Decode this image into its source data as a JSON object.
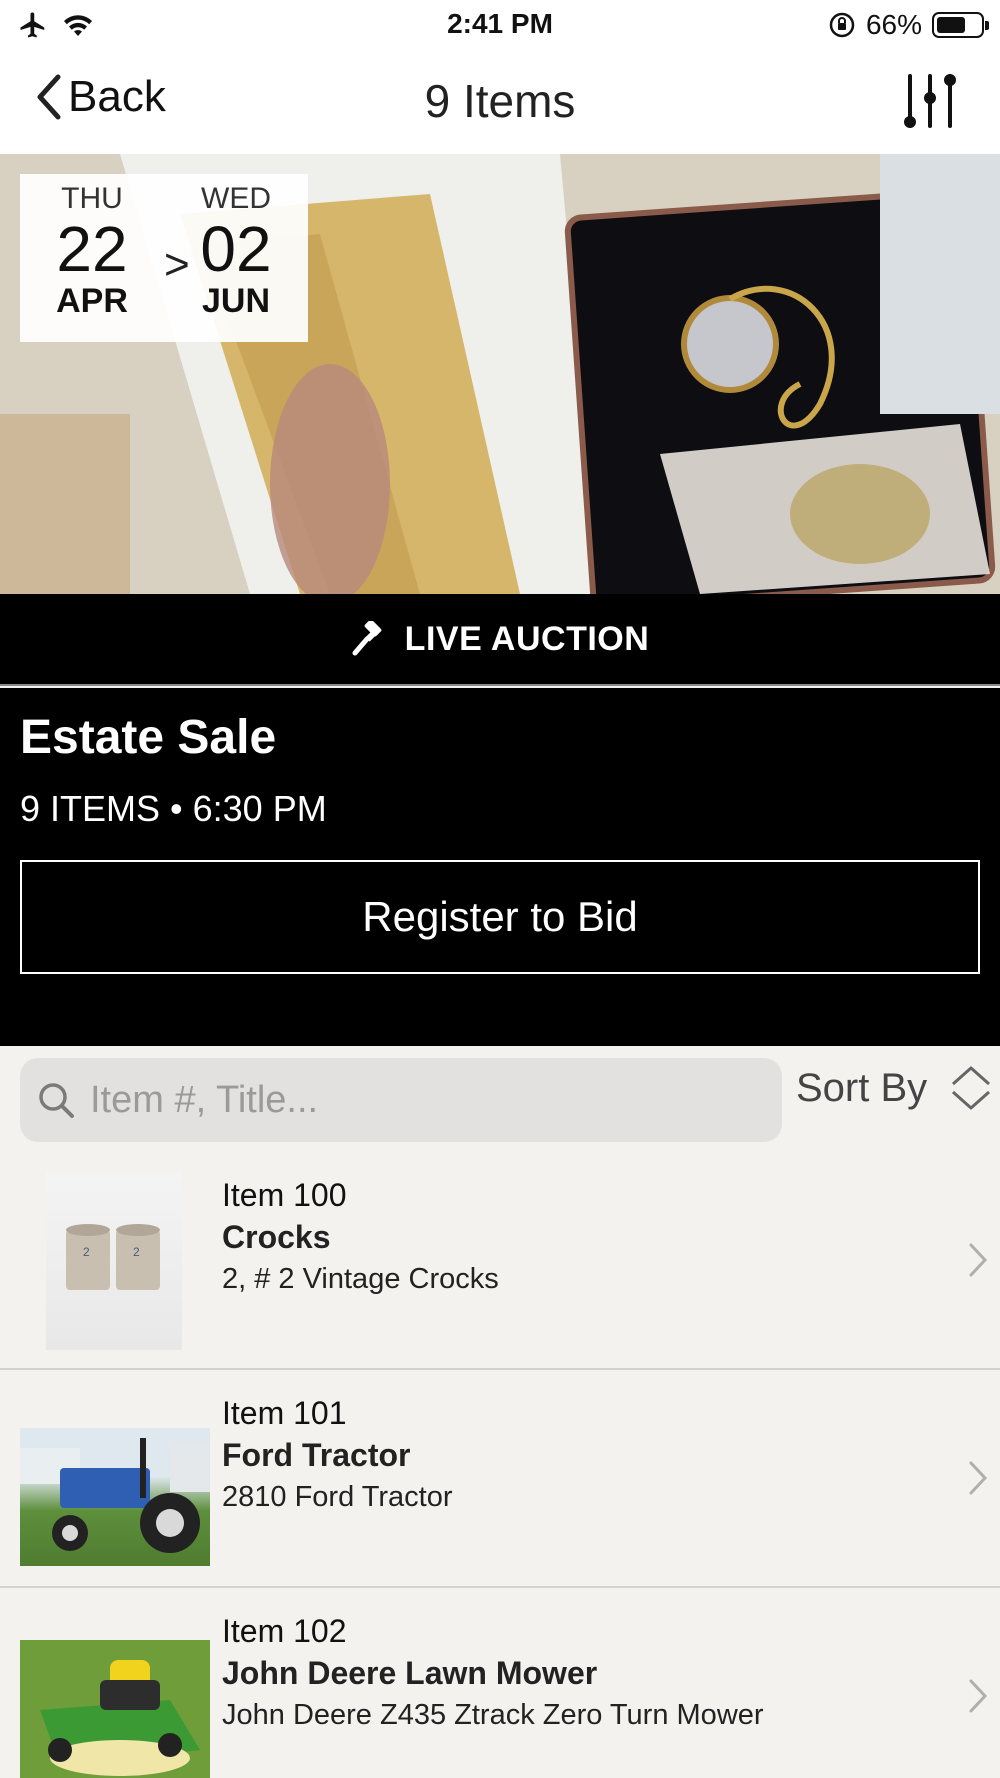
{
  "status_bar": {
    "time": "2:41 PM",
    "battery_percent": "66%",
    "battery_level": 0.66
  },
  "nav": {
    "back_label": "Back",
    "title": "9 Items"
  },
  "hero": {
    "start": {
      "dow": "THU",
      "day": "22",
      "month": "APR"
    },
    "arrow": ">",
    "end": {
      "dow": "WED",
      "day": "02",
      "month": "JUN"
    }
  },
  "auction": {
    "type_label": "LIVE AUCTION",
    "title": "Estate Sale",
    "meta": "9 ITEMS • 6:30 PM",
    "register_label": "Register to Bid"
  },
  "search": {
    "placeholder": "Item #, Title...",
    "sort_label": "Sort By"
  },
  "items": [
    {
      "number": "Item 100",
      "title": "Crocks",
      "desc": "2, # 2 Vintage Crocks",
      "thumb": "crocks"
    },
    {
      "number": "Item 101",
      "title": "Ford Tractor",
      "desc": "2810 Ford Tractor",
      "thumb": "tractor"
    },
    {
      "number": "Item 102",
      "title": "John Deere Lawn Mower",
      "desc": "John Deere Z435 Ztrack Zero Turn Mower",
      "thumb": "mower"
    }
  ],
  "colors": {
    "background": "#f3f2ef",
    "banner": "#000000",
    "search_fill": "#e2e1df"
  }
}
